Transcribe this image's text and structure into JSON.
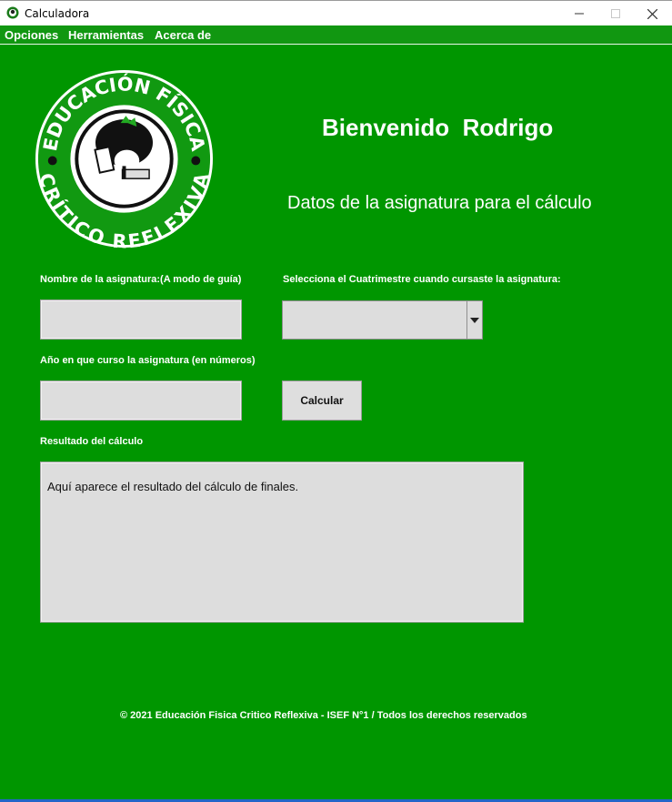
{
  "window": {
    "title": "Calculadora",
    "controls": {
      "minimize_icon": "minimize-icon",
      "maximize_icon": "maximize-icon",
      "close_icon": "close-icon"
    }
  },
  "menu": {
    "items": [
      "Opciones",
      "Herramientas",
      "Acerca de"
    ]
  },
  "logo": {
    "top_text": "EDUCACIÓN FÍSICA",
    "bottom_text": "CRÍTICO REFLEXIVA"
  },
  "header": {
    "welcome": "Bienvenido  Rodrigo",
    "subtitle": "Datos de la asignatura para el cálculo"
  },
  "form": {
    "subject_name_label": "Nombre de la asignatura:(A modo de guía)",
    "subject_name_value": "",
    "semester_label": "Selecciona el Cuatrimestre cuando cursaste la asignatura:",
    "semester_value": "",
    "year_label": "Año en que curso la asignatura (en números)",
    "year_value": "",
    "calculate_button": "Calcular",
    "result_label": "Resultado del cálculo",
    "result_text": "Aquí aparece el resultado del cálculo de finales."
  },
  "footer": {
    "text": "© 2021 Educación Fisica Critico Reflexiva - ISEF N°1 / Todos los derechos reservados"
  },
  "colors": {
    "background": "#009600",
    "menubar": "#119711",
    "field": "#dddddd",
    "text": "#ffffff"
  }
}
